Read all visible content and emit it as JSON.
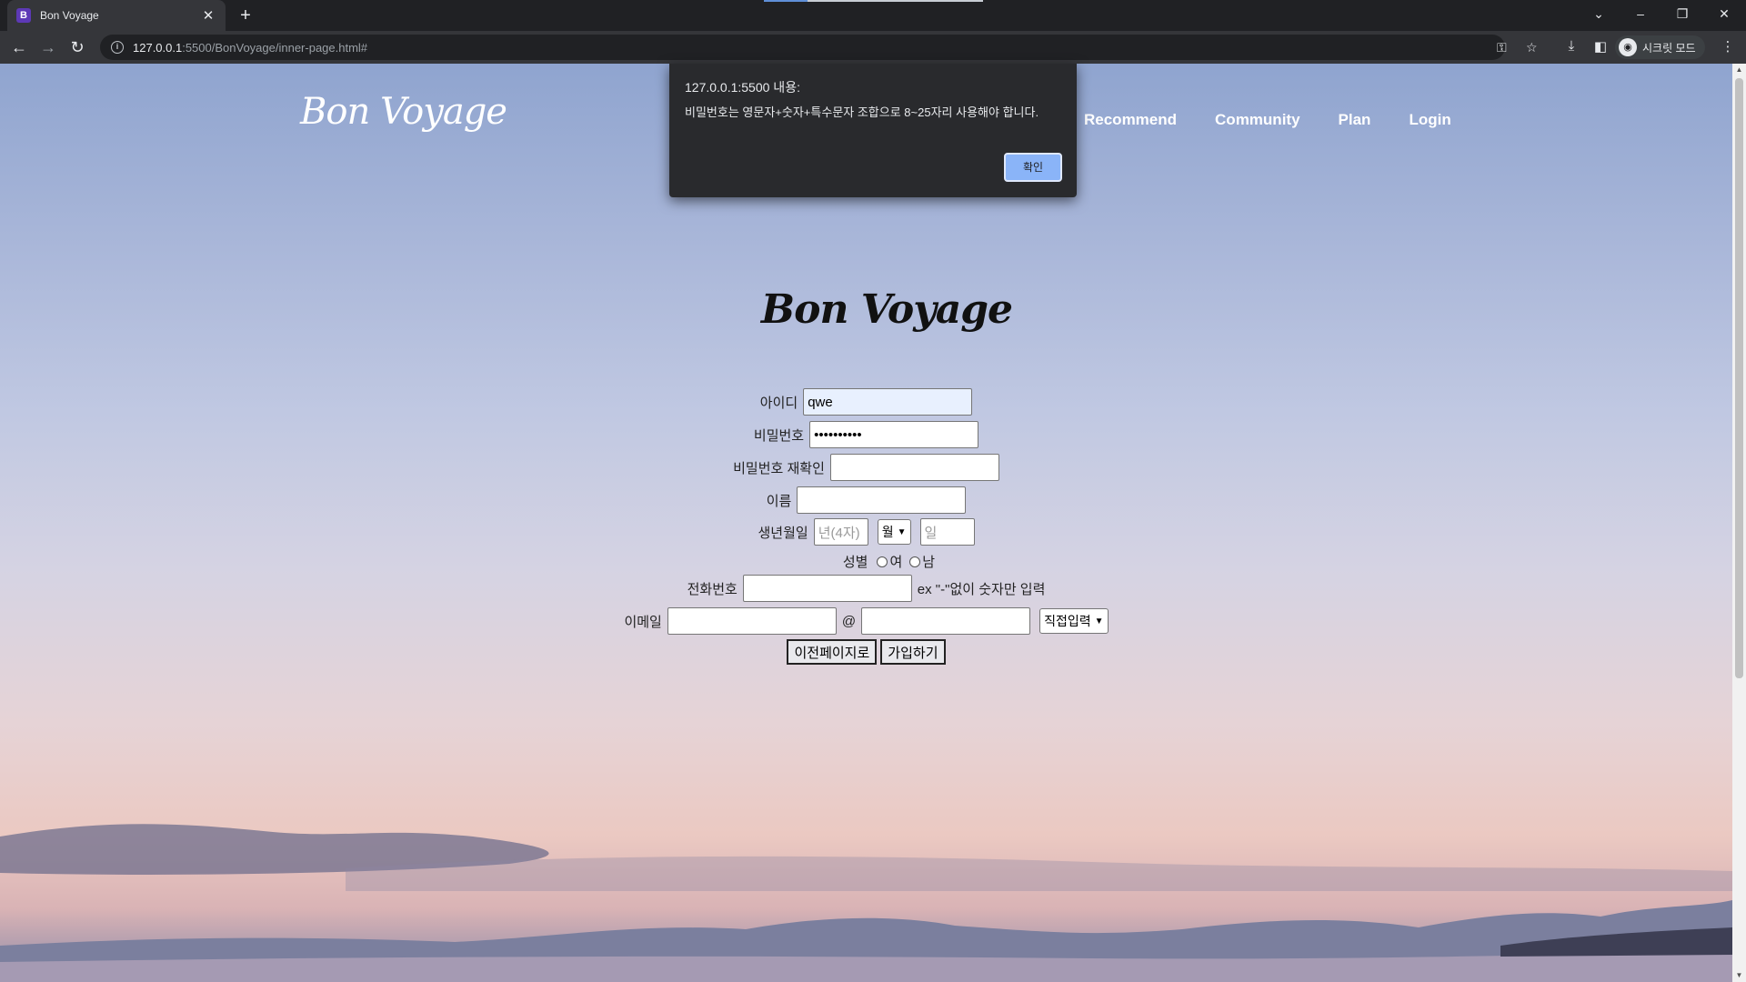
{
  "browser": {
    "tab_title": "Bon Voyage",
    "tab_favicon_letter": "B",
    "url_host": "127.0.0.1",
    "url_path": ":5500/BonVoyage/inner-page.html#",
    "profile_label": "시크릿 모드"
  },
  "site": {
    "logo": "Bon Voyage",
    "nav": [
      "Recommend",
      "Community",
      "Plan",
      "Login"
    ]
  },
  "form": {
    "logo": "Bon Voyage",
    "id_label": "아이디",
    "id_value": "qwe",
    "pw_label": "비밀번호",
    "pw_value": "••••••••••",
    "pw_confirm_label": "비밀번호 재확인",
    "name_label": "이름",
    "birth_label": "생년월일",
    "birth_year_placeholder": "년(4자)",
    "birth_month_value": "월",
    "birth_day_placeholder": "일",
    "gender_label": "성별",
    "gender_female": "여",
    "gender_male": "남",
    "phone_label": "전화번호",
    "phone_hint": "ex \"-\"없이 숫자만 입력",
    "email_label": "이메일",
    "email_at": "@",
    "email_domain_select": "직접입력",
    "prev_button": "이전페이지로",
    "submit_button": "가입하기"
  },
  "dialog": {
    "title": "127.0.0.1:5500 내용:",
    "message": "비밀번호는 영문자+숫자+특수문자 조합으로 8~25자리 사용해야 합니다.",
    "ok_button": "확인"
  },
  "colors": {
    "dialog_button": "#8ab4f8",
    "chrome_dark": "#202124",
    "autofill_blue": "#e8f0fe"
  }
}
